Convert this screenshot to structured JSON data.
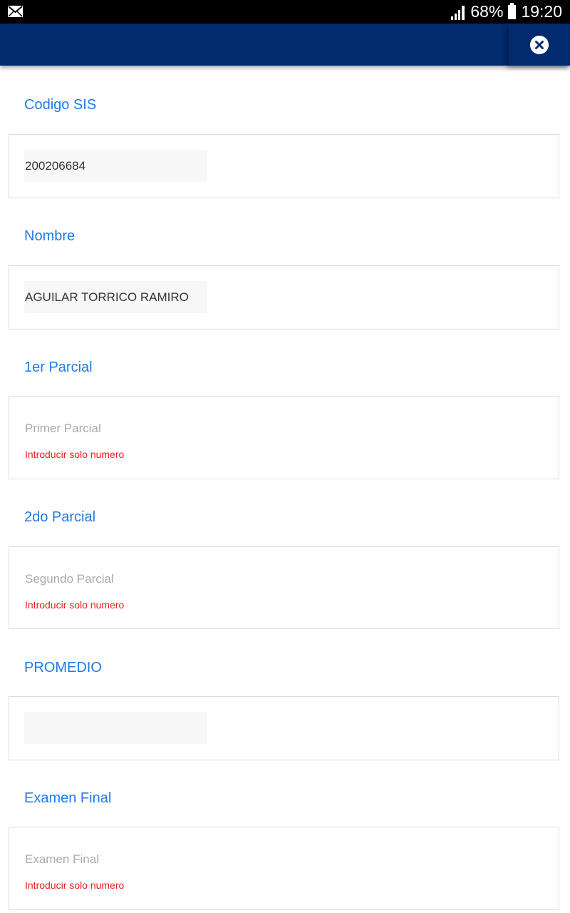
{
  "status_bar": {
    "battery_percent": "68%",
    "time": "19:20",
    "icons": [
      "mail-icon",
      "signal-icon",
      "battery-icon"
    ]
  },
  "app_bar": {
    "close_icon": "close-circle-icon",
    "color": "#022a6e"
  },
  "colors": {
    "label": "#1e7be6",
    "error": "#ee1c1c",
    "placeholder": "#aaaaaa"
  },
  "form": {
    "codigo": {
      "label": "Codigo SIS",
      "value": "200206684"
    },
    "nombre": {
      "label": "Nombre",
      "value": "AGUILAR TORRICO RAMIRO"
    },
    "parcial1": {
      "label": "1er Parcial",
      "placeholder": "Primer Parcial",
      "error": "Introducir solo numero"
    },
    "parcial2": {
      "label": "2do Parcial",
      "placeholder": "Segundo Parcial",
      "error": "Introducir solo numero"
    },
    "promedio": {
      "label": "PROMEDIO",
      "value": ""
    },
    "final": {
      "label": "Examen Final",
      "placeholder": "Examen Final",
      "error": "Introducir solo numero"
    }
  }
}
